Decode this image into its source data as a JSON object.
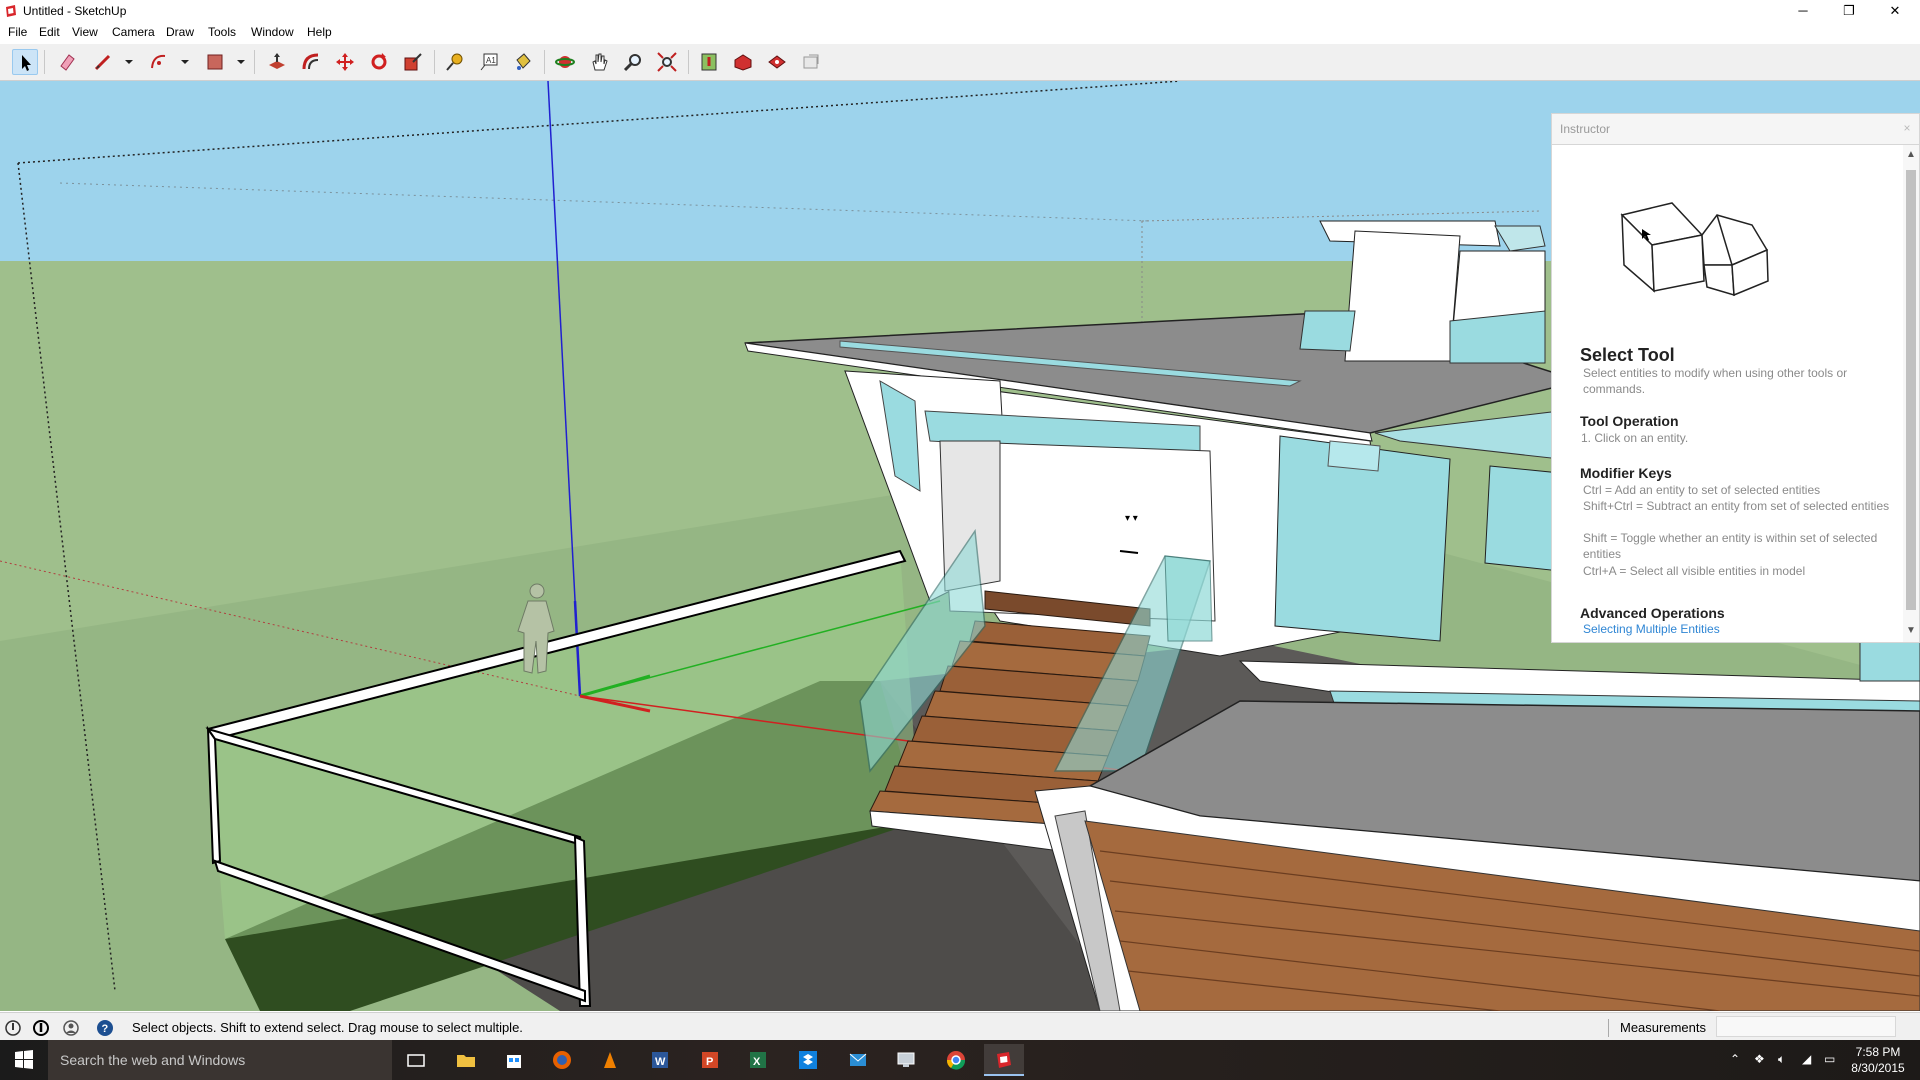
{
  "window": {
    "title": "Untitled - SketchUp",
    "minimize_glyph": "─",
    "restore_glyph": "❐",
    "close_glyph": "✕"
  },
  "menu": [
    "File",
    "Edit",
    "View",
    "Camera",
    "Draw",
    "Tools",
    "Window",
    "Help"
  ],
  "toolbar": {
    "tools": [
      "select-tool-icon",
      "eraser-tool-icon",
      "line-tool-icon",
      "arc-tool-icon",
      "rectangle-tool-icon",
      "push-pull-tool-icon",
      "offset-tool-icon",
      "move-tool-icon",
      "rotate-tool-icon",
      "scale-tool-icon",
      "tape-measure-tool-icon",
      "text-tool-icon",
      "paint-bucket-tool-icon",
      "orbit-tool-icon",
      "pan-tool-icon",
      "zoom-tool-icon",
      "zoom-extents-tool-icon",
      "add-location-icon",
      "3d-warehouse-icon",
      "extension-warehouse-icon",
      "layout-send-icon"
    ],
    "active_tool": "select-tool-icon"
  },
  "instructor": {
    "panel_title": "Instructor",
    "close_glyph": "×",
    "heading": "Select Tool",
    "description": "Select entities to modify when using other tools or commands.",
    "tool_operation": {
      "heading": "Tool Operation",
      "steps": [
        "1.   Click on an entity."
      ]
    },
    "modifier_keys": {
      "heading": "Modifier Keys",
      "items": [
        "Ctrl = Add an entity to set of selected entities",
        "Shift+Ctrl = Subtract an entity from set of selected entities",
        "Shift = Toggle whether an entity is within set of selected entities",
        "Ctrl+A = Select all visible entities in model"
      ]
    },
    "advanced": {
      "heading": "Advanced Operations",
      "link": "Selecting Multiple Entities"
    }
  },
  "status": {
    "hint": "Select objects. Shift to extend select. Drag mouse to select multiple.",
    "measurements_label": "Measurements",
    "measurements_value": ""
  },
  "taskbar": {
    "search_placeholder": "Search the web and Windows",
    "apps": [
      "task-view-icon",
      "file-explorer-icon",
      "store-icon",
      "firefox-icon",
      "vlc-icon",
      "word-icon",
      "powerpoint-icon",
      "excel-icon",
      "dropbox-icon",
      "mail-icon",
      "remote-desktop-icon",
      "chrome-icon",
      "sketchup-icon"
    ],
    "active_app": "sketchup-icon",
    "time": "7:58 PM",
    "date": "8/30/2015"
  },
  "colors": {
    "sky": "#9dd3ec",
    "ground": "#9fbf8c",
    "axis_red": "#d12020",
    "axis_green": "#22b022",
    "axis_blue": "#2020d0",
    "link": "#2f86d4"
  }
}
